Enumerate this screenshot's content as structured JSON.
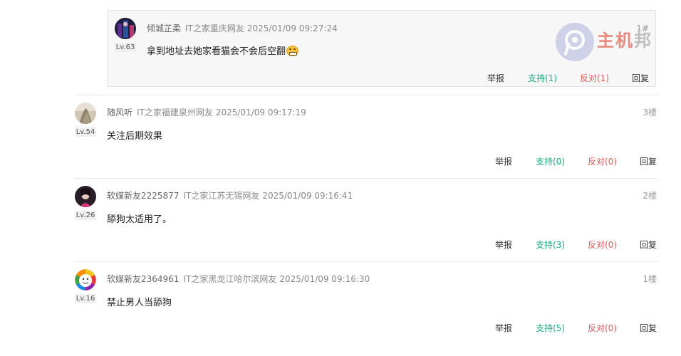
{
  "nested_reply": {
    "username": "倾城芷柔",
    "source": "IT之家重庆网友",
    "time": "2025/01/09 09:27:24",
    "floor": "1#",
    "level": "Lv.63",
    "content": "拿到地址去她家看猫会不会后空翻",
    "emoji_icon": "grimace-emoji-icon",
    "actions": {
      "report": "举报",
      "support": "支持(1)",
      "oppose": "反对(1)",
      "reply": "回复"
    }
  },
  "comments": [
    {
      "username": "随风听",
      "source": "IT之家福建泉州网友",
      "time": "2025/01/09 09:17:19",
      "floor": "3楼",
      "level": "Lv.54",
      "content": "关注后期效果",
      "actions": {
        "report": "举报",
        "support": "支持(0)",
        "oppose": "反对(0)",
        "reply": "回复"
      }
    },
    {
      "username": "软媒新友2225877",
      "source": "IT之家江苏无锡网友",
      "time": "2025/01/09 09:16:41",
      "floor": "2楼",
      "level": "Lv.26",
      "content": "舔狗太适用了。",
      "actions": {
        "report": "举报",
        "support": "支持(3)",
        "oppose": "反对(0)",
        "reply": "回复"
      }
    },
    {
      "username": "软媒新友2364961",
      "source": "IT之家黑龙江哈尔滨网友",
      "time": "2025/01/09 09:16:30",
      "floor": "1楼",
      "level": "Lv.16",
      "content": "禁止男人当舔狗",
      "actions": {
        "report": "举报",
        "support": "支持(5)",
        "oppose": "反对(0)",
        "reply": "回复"
      }
    }
  ],
  "watermark": {
    "brand_a": "主机",
    "brand_b": "邦"
  },
  "colors": {
    "support": "#1aad7f",
    "oppose": "#e55a54",
    "meta": "#888888"
  }
}
